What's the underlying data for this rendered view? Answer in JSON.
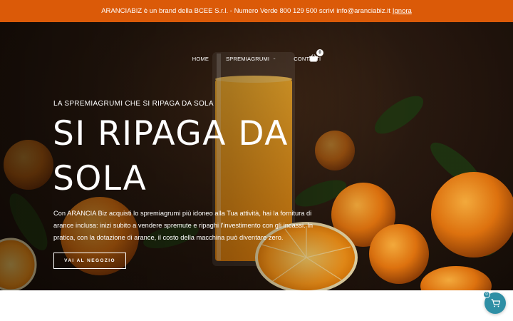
{
  "notice": {
    "message": "ARANCIABIZ è un brand della BCEE S.r.l. - Numero Verde 800 129 500 scrivi info@aranciabiz.it",
    "dismiss_label": "Ignora"
  },
  "nav": {
    "items": [
      {
        "label": "HOME"
      },
      {
        "label": "SPREMIAGRUMI",
        "icon": "chevron-down-icon"
      },
      {
        "label": "CONTATTI"
      }
    ],
    "cart_icon": "shopping-basket-icon",
    "cart_count": "0"
  },
  "hero": {
    "kicker": "LA SPREMIAGRUMI CHE SI RIPAGA DA SOLA",
    "headline": "SI RIPAGA DA SOLA",
    "lead": "Con ARANCIA Biz acquisti lo spremiagrumi più idoneo alla Tua attività, hai la fornitura di arance inclusa: inizi subito a vendere spremute e ripaghi l'investimento con gli incassi. In pratica, con la dotazione di arance, il costo della macchina può diventare zero.",
    "cta_label": "VAI AL NEGOZIO"
  },
  "floating_cart": {
    "icon": "cart-icon",
    "count": "0"
  },
  "colors": {
    "notice_bg": "#db5a08",
    "fab_bg": "#2f8fa5",
    "text_on_dark": "#ffffff"
  }
}
